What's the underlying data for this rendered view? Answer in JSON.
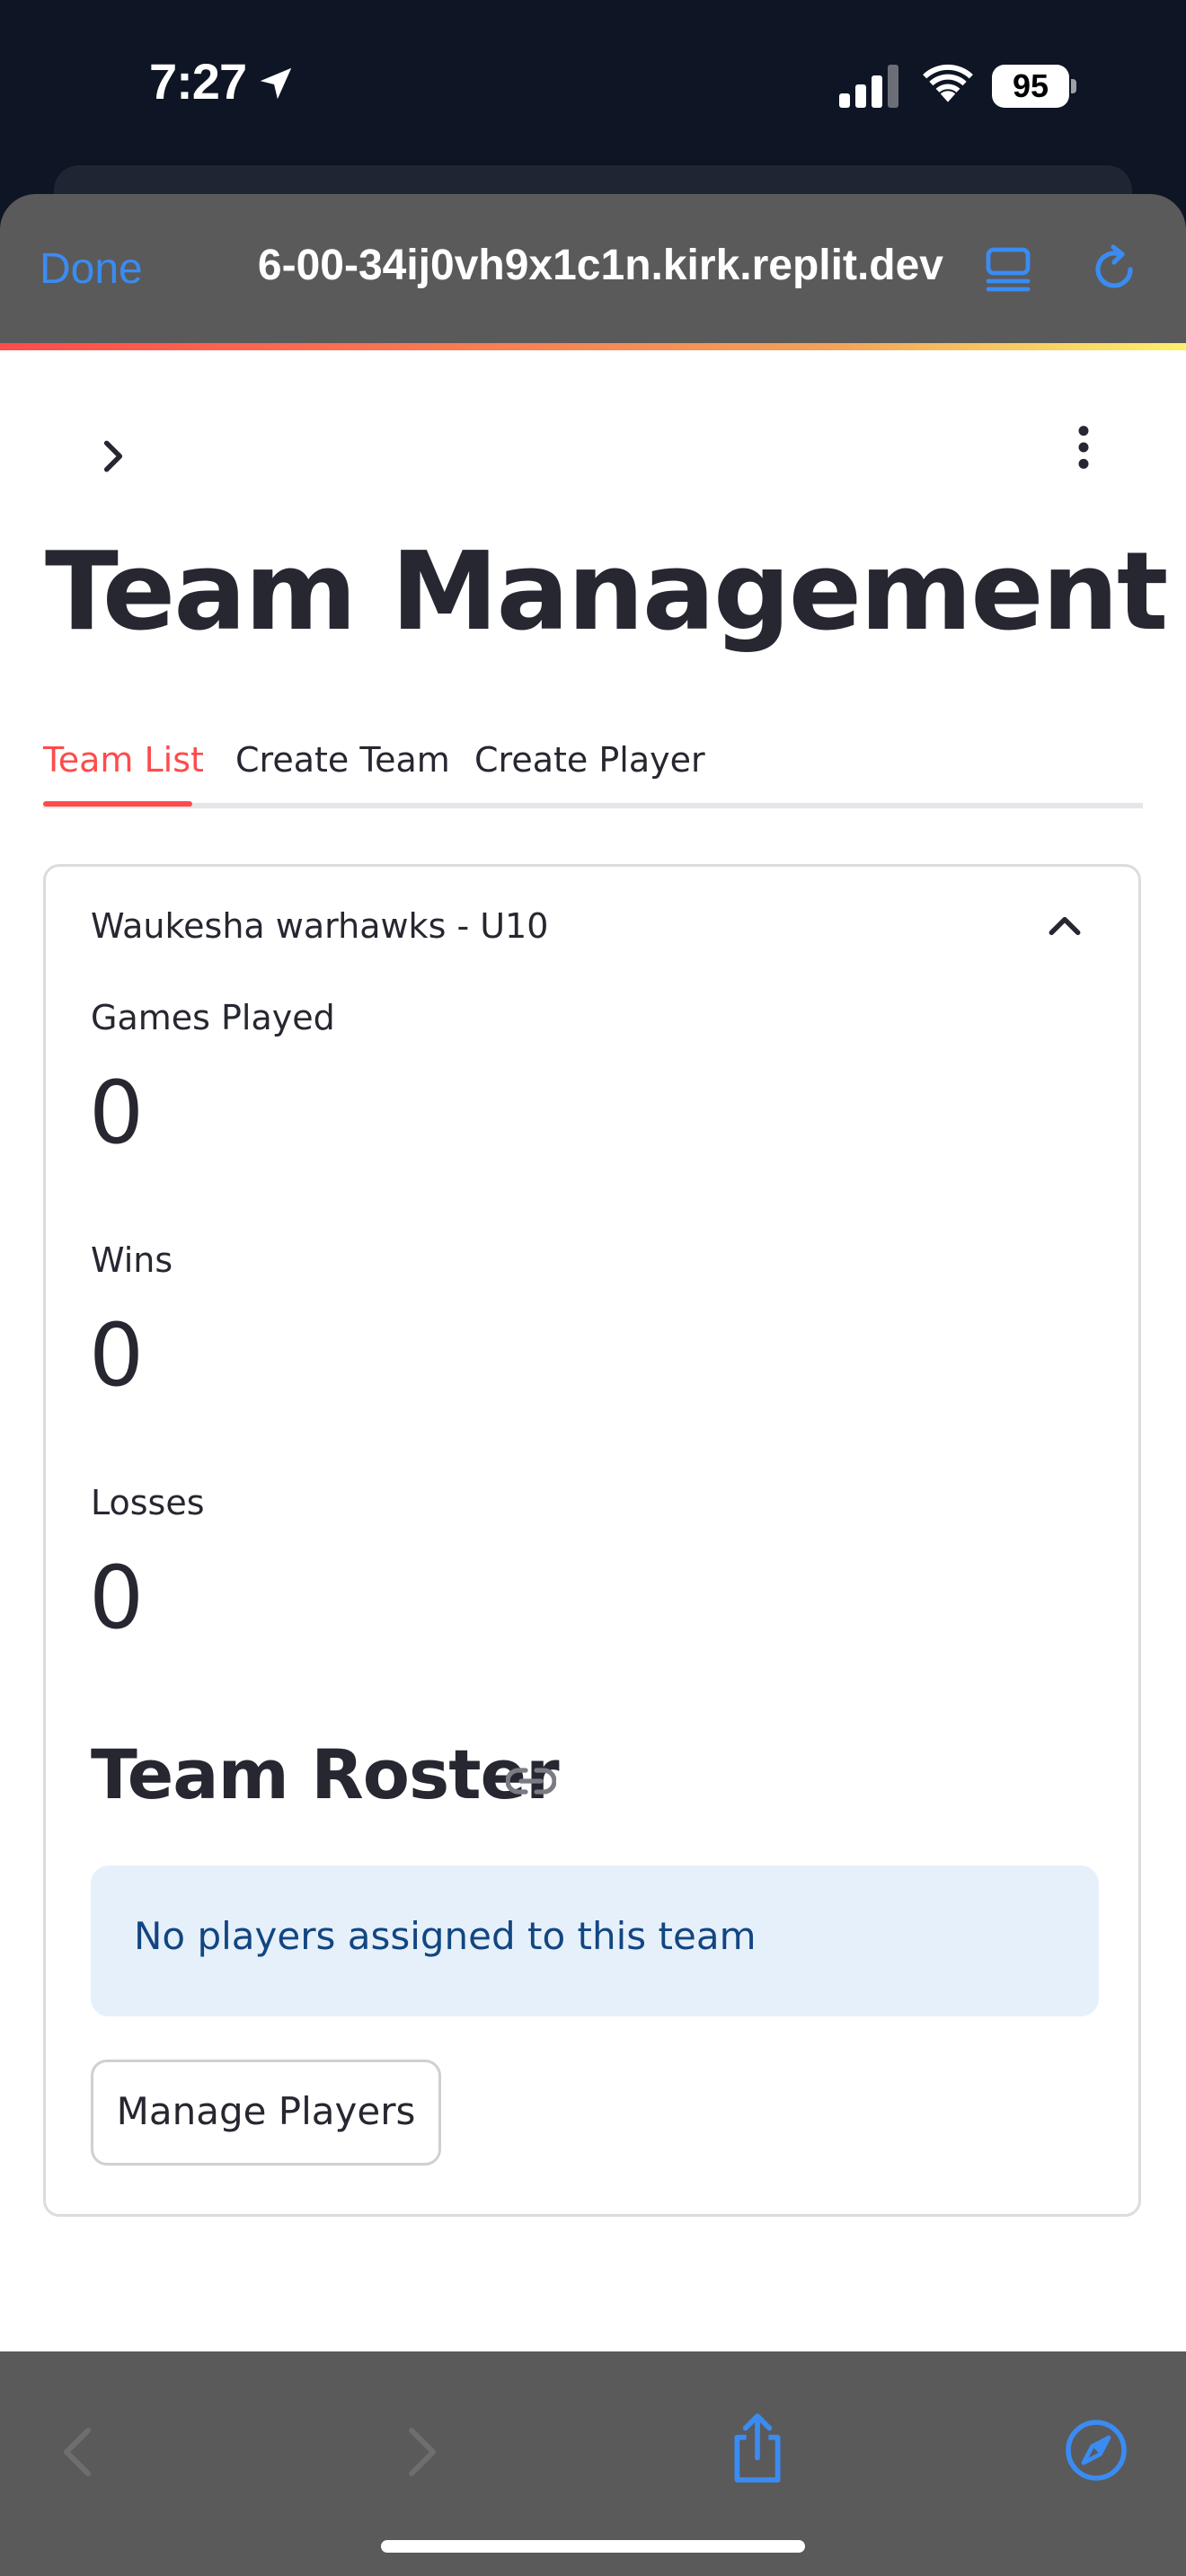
{
  "status_bar": {
    "time": "7:27",
    "battery": "95"
  },
  "browser": {
    "done_label": "Done",
    "url": "6-00-34ij0vh9x1c1n.kirk.replit.dev"
  },
  "page": {
    "title": "Team Management",
    "tabs": [
      {
        "label": "Team List",
        "active": true
      },
      {
        "label": "Create Team",
        "active": false
      },
      {
        "label": "Create Player",
        "active": false
      }
    ],
    "team": {
      "header": "Waukesha warhawks - U10",
      "metrics": [
        {
          "label": "Games Played",
          "value": "0"
        },
        {
          "label": "Wins",
          "value": "0"
        },
        {
          "label": "Losses",
          "value": "0"
        }
      ],
      "roster_title": "Team Roster",
      "roster_info": "No players assigned to this team",
      "manage_button": "Manage Players"
    }
  },
  "colors": {
    "accent": "#ff4b4b",
    "link_blue": "#3a8cf2",
    "info_bg": "#e6f0fb",
    "info_text": "#124682"
  }
}
